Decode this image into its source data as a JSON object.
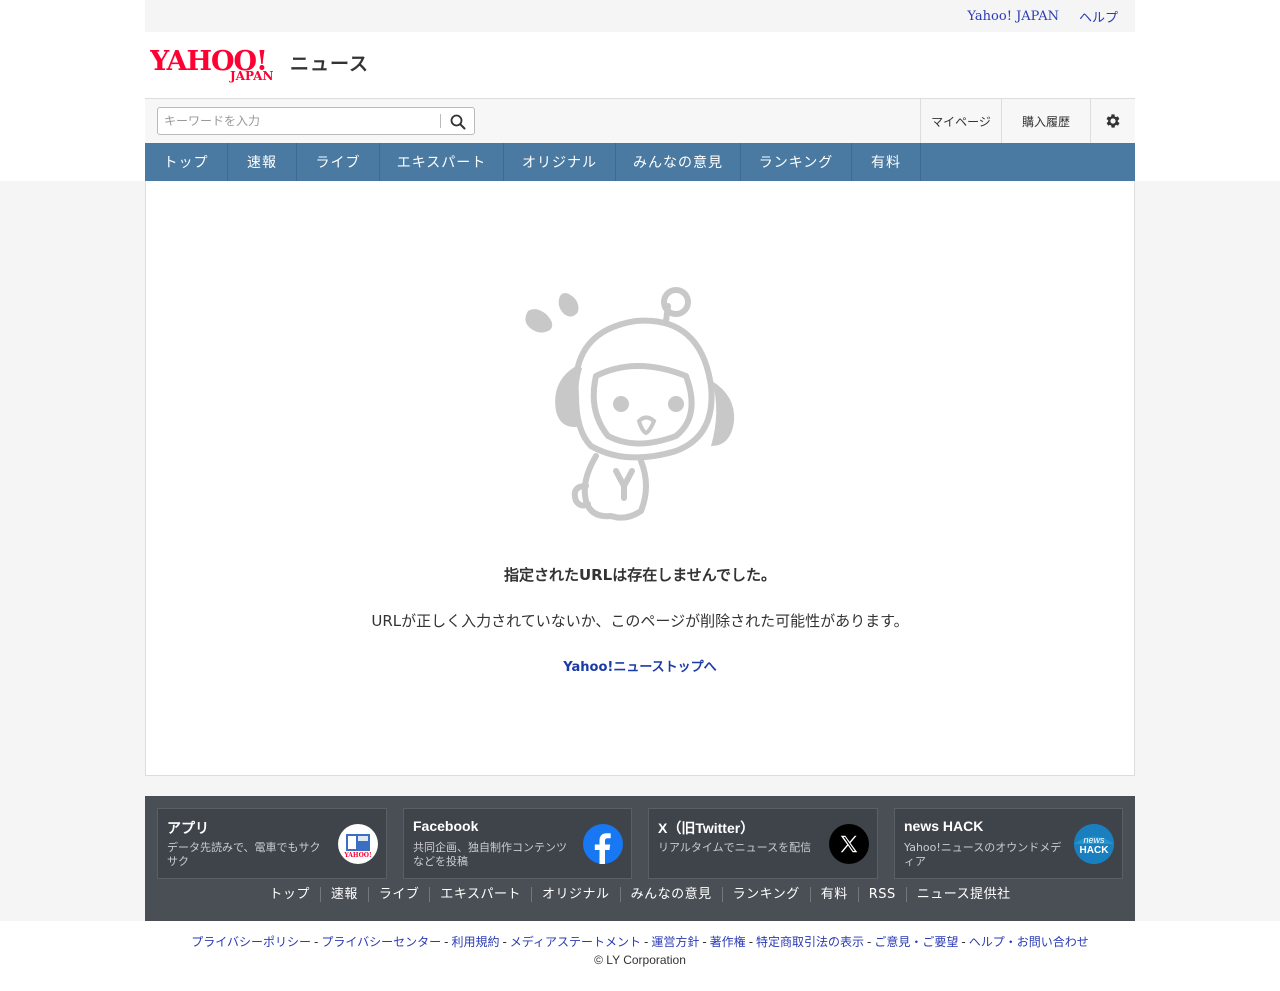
{
  "header": {
    "util_links": [
      "Yahoo! JAPAN",
      "ヘルプ"
    ],
    "logo_text": "YAHOO!",
    "logo_sub": "JAPAN",
    "logo_news": "ニュース"
  },
  "search": {
    "placeholder": "キーワードを入力",
    "mypage": "マイページ",
    "history": "購入履歴"
  },
  "nav": {
    "items": [
      "トップ",
      "速報",
      "ライブ",
      "エキスパート",
      "オリジナル",
      "みんなの意見",
      "ランキング",
      "有料"
    ]
  },
  "error": {
    "title": "指定されたURLは存在しませんでした。",
    "description": "URLが正しく入力されていないか、このページが削除された可能性があります。",
    "link": "Yahoo!ニューストップへ"
  },
  "sns": [
    {
      "title": "アプリ",
      "desc": "データ先読みで、電車でもサクサク",
      "icon": "app-icon"
    },
    {
      "title": "Facebook",
      "desc": "共同企画、独自制作コンテンツなどを投稿",
      "icon": "facebook-icon"
    },
    {
      "title": "X（旧Twitter）",
      "desc": "リアルタイムでニュースを配信",
      "icon": "x-icon"
    },
    {
      "title": "news HACK",
      "desc": "Yahoo!ニュースのオウンドメディア",
      "icon": "newshack-icon"
    }
  ],
  "footer_links": [
    "トップ",
    "速報",
    "ライブ",
    "エキスパート",
    "オリジナル",
    "みんなの意見",
    "ランキング",
    "有料",
    "RSS",
    "ニュース提供社"
  ],
  "legal_links": [
    "プライバシーポリシー",
    "プライバシーセンター",
    "利用規約",
    "メディアステートメント",
    "運営方針",
    "著作権",
    "特定商取引法の表示",
    "ご意見・ご要望",
    "ヘルプ・お問い合わせ"
  ],
  "copyright": "© LY Corporation",
  "colors": {
    "nav_bg": "#4a7aa1",
    "footer_bg": "#4a4f55",
    "link": "#2a3ab5",
    "brand_red": "#ff0033"
  }
}
